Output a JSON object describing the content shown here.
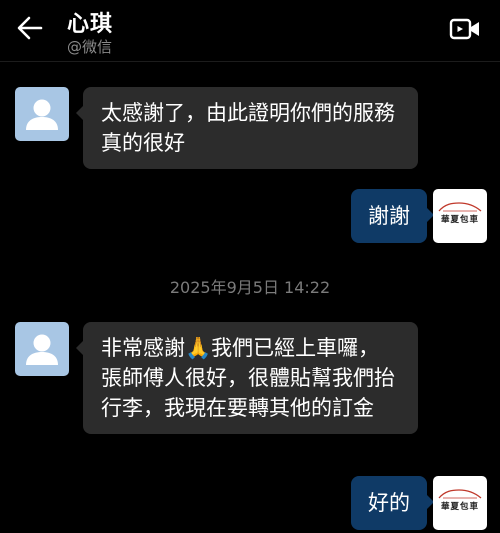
{
  "header": {
    "contact_name": "心琪",
    "contact_source": "@微信"
  },
  "icons": {
    "back": "back-arrow-icon",
    "video_call": "video-call-icon",
    "contact_avatar": "default-person-avatar",
    "self_avatar": "company-logo-avatar"
  },
  "self_avatar": {
    "brand_text": "華夏包車"
  },
  "messages": [
    {
      "direction": "incoming",
      "text": "太感謝了，由此證明你們的服務真的很好"
    },
    {
      "direction": "outgoing",
      "text": "謝謝"
    },
    {
      "direction": "system",
      "text": "2025年9月5日  14:22"
    },
    {
      "direction": "incoming",
      "text": "非常感謝🙏我們已經上車囉，張師傅人很好，很體貼幫我們抬行李，我現在要轉其他的訂金"
    },
    {
      "direction": "outgoing",
      "text": "好的"
    }
  ],
  "colors": {
    "background": "#000000",
    "incoming_bubble": "#2c2c2c",
    "outgoing_bubble": "#0f3a66",
    "timestamp": "#7b7b7b",
    "contact_avatar_bg": "#a8c6e4"
  }
}
